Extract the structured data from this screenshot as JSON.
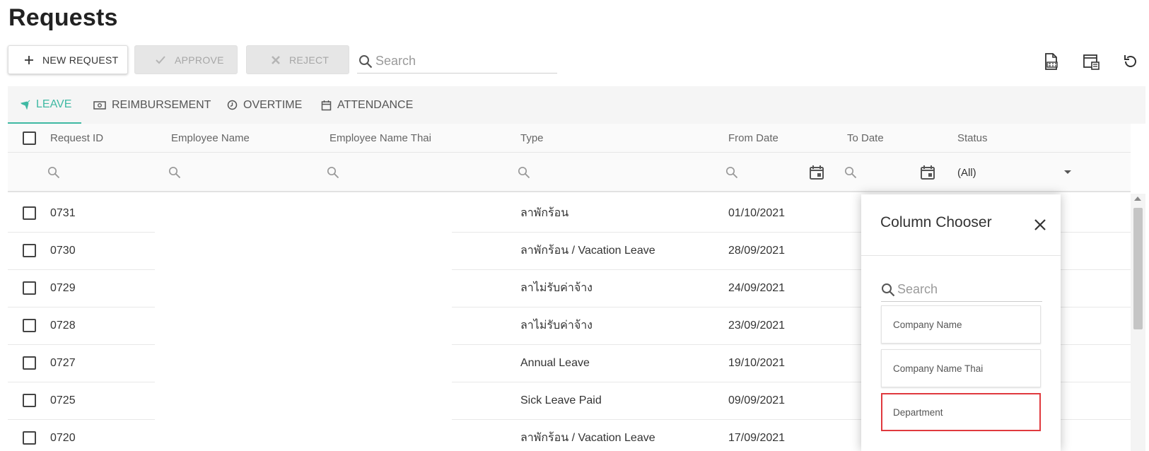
{
  "page": {
    "title": "Requests"
  },
  "toolbar": {
    "new_request": "NEW REQUEST",
    "approve": "APPROVE",
    "reject": "REJECT",
    "search_placeholder": "Search",
    "icons": [
      "export-document-icon",
      "column-chooser-icon",
      "refresh-icon"
    ]
  },
  "tabs": [
    {
      "label": "LEAVE",
      "icon": "airplane-icon",
      "active": true
    },
    {
      "label": "REIMBURSEMENT",
      "icon": "money-icon",
      "active": false
    },
    {
      "label": "OVERTIME",
      "icon": "clock-icon",
      "active": false
    },
    {
      "label": "ATTENDANCE",
      "icon": "calendar-icon",
      "active": false
    }
  ],
  "grid": {
    "columns": [
      "Request ID",
      "Employee Name",
      "Employee Name Thai",
      "Type",
      "From Date",
      "To Date",
      "Status"
    ],
    "status_filter": "(All)",
    "rows": [
      {
        "id": "0731",
        "type": "ลาพักร้อน",
        "from": "01/10/2021"
      },
      {
        "id": "0730",
        "type": "ลาพักร้อน / Vacation Leave",
        "from": "28/09/2021"
      },
      {
        "id": "0729",
        "type": "ลาไม่รับค่าจ้าง",
        "from": "24/09/2021"
      },
      {
        "id": "0728",
        "type": "ลาไม่รับค่าจ้าง",
        "from": "23/09/2021"
      },
      {
        "id": "0727",
        "type": "Annual Leave",
        "from": "19/10/2021"
      },
      {
        "id": "0725",
        "type": "Sick Leave Paid",
        "from": "09/09/2021"
      },
      {
        "id": "0720",
        "type": "ลาพักร้อน / Vacation Leave",
        "from": "17/09/2021"
      }
    ]
  },
  "column_chooser": {
    "title": "Column Chooser",
    "search_placeholder": "Search",
    "items": [
      "Company Name",
      "Company Name Thai",
      "Department"
    ],
    "highlighted": "Department"
  },
  "colors": {
    "accent": "#3fb9a3",
    "highlight": "#e0393e"
  }
}
